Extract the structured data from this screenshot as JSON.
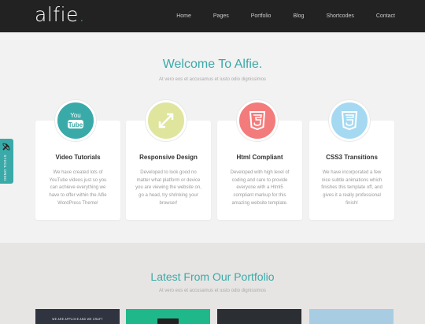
{
  "brand": {
    "name": "alfie",
    "dot": ".",
    "accent": "#3aaaa9"
  },
  "nav": {
    "items": [
      "Home",
      "Pages",
      "Portfolio",
      "Blog",
      "Shortcodes",
      "Contact"
    ]
  },
  "welcome": {
    "title": "Welcome To Alfie.",
    "subtitle": "At vero eos et accusamus et iusto odio dignissimos",
    "features": [
      {
        "title": "Video Tutorials",
        "text": "We have created lots of YouTube videos just so you can achieve everything we have to offer within the Alfie WordPress Theme!",
        "icon": "youtube-icon",
        "color": "#3aaaa9",
        "icon_text": "You Tube"
      },
      {
        "title": "Responsive Design",
        "text": "Developed to look good no matter what platform or device you are viewing the website on, go a head, try shrinking your browser!",
        "icon": "expand-arrows-icon",
        "color": "#dfe59d"
      },
      {
        "title": "Html Compliant",
        "text": "Developed with high level of coding and care to provide everyone with a Html5 compliant markup for this amazing website template.",
        "icon": "html5-icon",
        "color": "#f47b7b",
        "icon_text": "5"
      },
      {
        "title": "CSS3 Transitions",
        "text": "We have incorporated a few nice subtle animations which finishes this template off, and gives it a really professional finish!",
        "icon": "css3-icon",
        "color": "#a5d9f1",
        "icon_text": "3"
      }
    ]
  },
  "demo_tools": {
    "label": "DEMO TOOLS",
    "icon": "tools-icon"
  },
  "portfolio": {
    "title": "Latest From Our Portfolio",
    "subtitle": "At vero eos et accusamus et iusto odio dignissimos",
    "thumbs": [
      {
        "color": "#2f3440",
        "caption": "WE ARE APPLOVE AND WE CRAFT"
      },
      {
        "color": "#1fb88a",
        "caption": ""
      },
      {
        "color": "#2b2e33",
        "caption": ""
      },
      {
        "color": "#a8cde3",
        "caption": ""
      }
    ]
  }
}
